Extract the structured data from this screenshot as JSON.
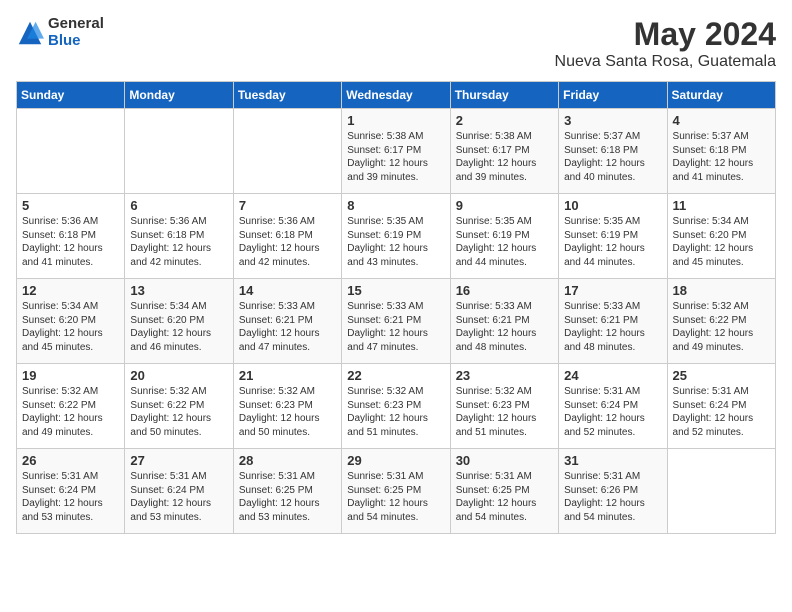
{
  "logo": {
    "general": "General",
    "blue": "Blue"
  },
  "header": {
    "month_year": "May 2024",
    "location": "Nueva Santa Rosa, Guatemala"
  },
  "days_of_week": [
    "Sunday",
    "Monday",
    "Tuesday",
    "Wednesday",
    "Thursday",
    "Friday",
    "Saturday"
  ],
  "weeks": [
    [
      {
        "day": "",
        "info": ""
      },
      {
        "day": "",
        "info": ""
      },
      {
        "day": "",
        "info": ""
      },
      {
        "day": "1",
        "info": "Sunrise: 5:38 AM\nSunset: 6:17 PM\nDaylight: 12 hours\nand 39 minutes."
      },
      {
        "day": "2",
        "info": "Sunrise: 5:38 AM\nSunset: 6:17 PM\nDaylight: 12 hours\nand 39 minutes."
      },
      {
        "day": "3",
        "info": "Sunrise: 5:37 AM\nSunset: 6:18 PM\nDaylight: 12 hours\nand 40 minutes."
      },
      {
        "day": "4",
        "info": "Sunrise: 5:37 AM\nSunset: 6:18 PM\nDaylight: 12 hours\nand 41 minutes."
      }
    ],
    [
      {
        "day": "5",
        "info": "Sunrise: 5:36 AM\nSunset: 6:18 PM\nDaylight: 12 hours\nand 41 minutes."
      },
      {
        "day": "6",
        "info": "Sunrise: 5:36 AM\nSunset: 6:18 PM\nDaylight: 12 hours\nand 42 minutes."
      },
      {
        "day": "7",
        "info": "Sunrise: 5:36 AM\nSunset: 6:18 PM\nDaylight: 12 hours\nand 42 minutes."
      },
      {
        "day": "8",
        "info": "Sunrise: 5:35 AM\nSunset: 6:19 PM\nDaylight: 12 hours\nand 43 minutes."
      },
      {
        "day": "9",
        "info": "Sunrise: 5:35 AM\nSunset: 6:19 PM\nDaylight: 12 hours\nand 44 minutes."
      },
      {
        "day": "10",
        "info": "Sunrise: 5:35 AM\nSunset: 6:19 PM\nDaylight: 12 hours\nand 44 minutes."
      },
      {
        "day": "11",
        "info": "Sunrise: 5:34 AM\nSunset: 6:20 PM\nDaylight: 12 hours\nand 45 minutes."
      }
    ],
    [
      {
        "day": "12",
        "info": "Sunrise: 5:34 AM\nSunset: 6:20 PM\nDaylight: 12 hours\nand 45 minutes."
      },
      {
        "day": "13",
        "info": "Sunrise: 5:34 AM\nSunset: 6:20 PM\nDaylight: 12 hours\nand 46 minutes."
      },
      {
        "day": "14",
        "info": "Sunrise: 5:33 AM\nSunset: 6:21 PM\nDaylight: 12 hours\nand 47 minutes."
      },
      {
        "day": "15",
        "info": "Sunrise: 5:33 AM\nSunset: 6:21 PM\nDaylight: 12 hours\nand 47 minutes."
      },
      {
        "day": "16",
        "info": "Sunrise: 5:33 AM\nSunset: 6:21 PM\nDaylight: 12 hours\nand 48 minutes."
      },
      {
        "day": "17",
        "info": "Sunrise: 5:33 AM\nSunset: 6:21 PM\nDaylight: 12 hours\nand 48 minutes."
      },
      {
        "day": "18",
        "info": "Sunrise: 5:32 AM\nSunset: 6:22 PM\nDaylight: 12 hours\nand 49 minutes."
      }
    ],
    [
      {
        "day": "19",
        "info": "Sunrise: 5:32 AM\nSunset: 6:22 PM\nDaylight: 12 hours\nand 49 minutes."
      },
      {
        "day": "20",
        "info": "Sunrise: 5:32 AM\nSunset: 6:22 PM\nDaylight: 12 hours\nand 50 minutes."
      },
      {
        "day": "21",
        "info": "Sunrise: 5:32 AM\nSunset: 6:23 PM\nDaylight: 12 hours\nand 50 minutes."
      },
      {
        "day": "22",
        "info": "Sunrise: 5:32 AM\nSunset: 6:23 PM\nDaylight: 12 hours\nand 51 minutes."
      },
      {
        "day": "23",
        "info": "Sunrise: 5:32 AM\nSunset: 6:23 PM\nDaylight: 12 hours\nand 51 minutes."
      },
      {
        "day": "24",
        "info": "Sunrise: 5:31 AM\nSunset: 6:24 PM\nDaylight: 12 hours\nand 52 minutes."
      },
      {
        "day": "25",
        "info": "Sunrise: 5:31 AM\nSunset: 6:24 PM\nDaylight: 12 hours\nand 52 minutes."
      }
    ],
    [
      {
        "day": "26",
        "info": "Sunrise: 5:31 AM\nSunset: 6:24 PM\nDaylight: 12 hours\nand 53 minutes."
      },
      {
        "day": "27",
        "info": "Sunrise: 5:31 AM\nSunset: 6:24 PM\nDaylight: 12 hours\nand 53 minutes."
      },
      {
        "day": "28",
        "info": "Sunrise: 5:31 AM\nSunset: 6:25 PM\nDaylight: 12 hours\nand 53 minutes."
      },
      {
        "day": "29",
        "info": "Sunrise: 5:31 AM\nSunset: 6:25 PM\nDaylight: 12 hours\nand 54 minutes."
      },
      {
        "day": "30",
        "info": "Sunrise: 5:31 AM\nSunset: 6:25 PM\nDaylight: 12 hours\nand 54 minutes."
      },
      {
        "day": "31",
        "info": "Sunrise: 5:31 AM\nSunset: 6:26 PM\nDaylight: 12 hours\nand 54 minutes."
      },
      {
        "day": "",
        "info": ""
      }
    ]
  ]
}
